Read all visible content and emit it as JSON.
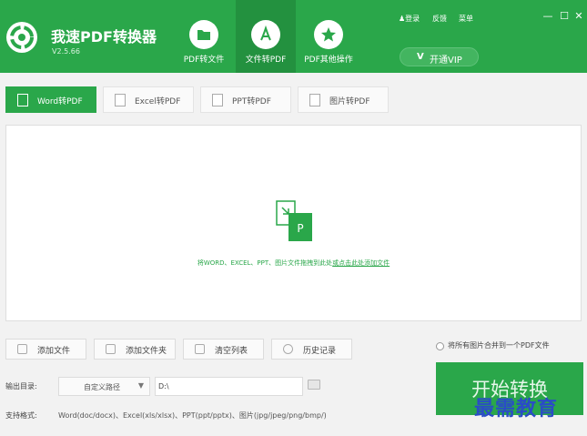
{
  "app": {
    "title": "我速PDF转换器",
    "version": "V2.5.66"
  },
  "nav": [
    {
      "label": "PDF转文件",
      "icon": "folder-icon"
    },
    {
      "label": "文件转PDF",
      "icon": "pdf-icon"
    },
    {
      "label": "PDF其他操作",
      "icon": "star-icon"
    }
  ],
  "top_links": {
    "login": "登录",
    "feedback": "反馈",
    "menu": "菜单"
  },
  "window_controls": {
    "minimize": "—",
    "maximize": "☐",
    "close": "✕"
  },
  "vip": {
    "icon": "vip-icon",
    "label": "开通VIP"
  },
  "sub_tabs": [
    {
      "label": "Word转PDF"
    },
    {
      "label": "Excel转PDF"
    },
    {
      "label": "PPT转PDF"
    },
    {
      "label": "图片转PDF"
    }
  ],
  "drop_zone": {
    "hint_prefix": "将WORD、EXCEL、PPT、图片文件拖拽到此处",
    "hint_link": "或点击此处添加文件",
    "icon": "convert-to-pdf-icon"
  },
  "actions": [
    {
      "label": "添加文件",
      "icon": "add-file-icon"
    },
    {
      "label": "添加文件夹",
      "icon": "add-folder-icon"
    },
    {
      "label": "清空列表",
      "icon": "trash-icon"
    },
    {
      "label": "历史记录",
      "icon": "history-icon"
    }
  ],
  "merge_option": {
    "label": "将所有图片合并到一个PDF文件",
    "checked": false
  },
  "output": {
    "label": "输出目录:",
    "mode": "自定义路径",
    "path": "D:\\"
  },
  "formats": {
    "label": "支持格式:",
    "value": "Word(doc/docx)、Excel(xls/xlsx)、PPT(ppt/pptx)、图片(jpg/jpeg/png/bmp/)"
  },
  "start_button": {
    "label": "开始转换"
  },
  "watermark": "最需教育",
  "colors": {
    "brand_green": "#2aa74a",
    "active_nav": "#23913f",
    "watermark": "#2a4cc7"
  }
}
